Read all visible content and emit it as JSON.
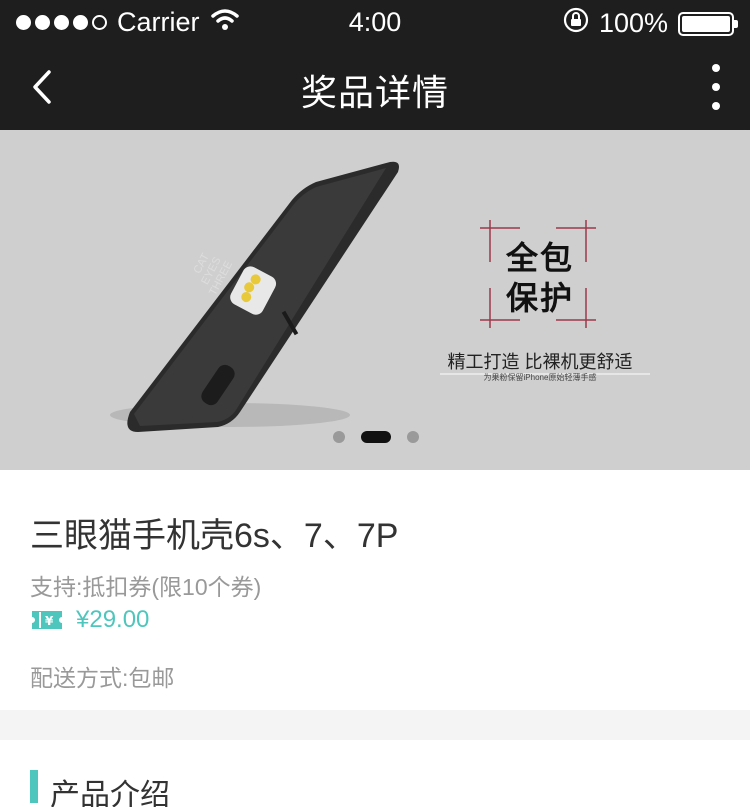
{
  "status_bar": {
    "carrier": "Carrier",
    "time": "4:00",
    "battery": "100%",
    "battery_level": 1.0
  },
  "nav": {
    "title": "奖品详情",
    "back_icon": "chevron-left-icon",
    "more_icon": "more-vertical-icon"
  },
  "banner": {
    "headline_line1": "全包",
    "headline_line2": "保护",
    "tagline": "精工打造 比裸机更舒适",
    "subtagline": "为果粉保留iPhone原始轻薄手感",
    "phone_print": "THREE EYES CAT",
    "pages": 3,
    "current_page": 2
  },
  "product": {
    "name": "三眼猫手机壳6s、7、7P",
    "support": "支持:抵扣券(限10个券)",
    "price": "¥29.00",
    "delivery": "配送方式:包邮",
    "accent_color": "#4ec6bd"
  },
  "section": {
    "title": "产品介绍"
  }
}
